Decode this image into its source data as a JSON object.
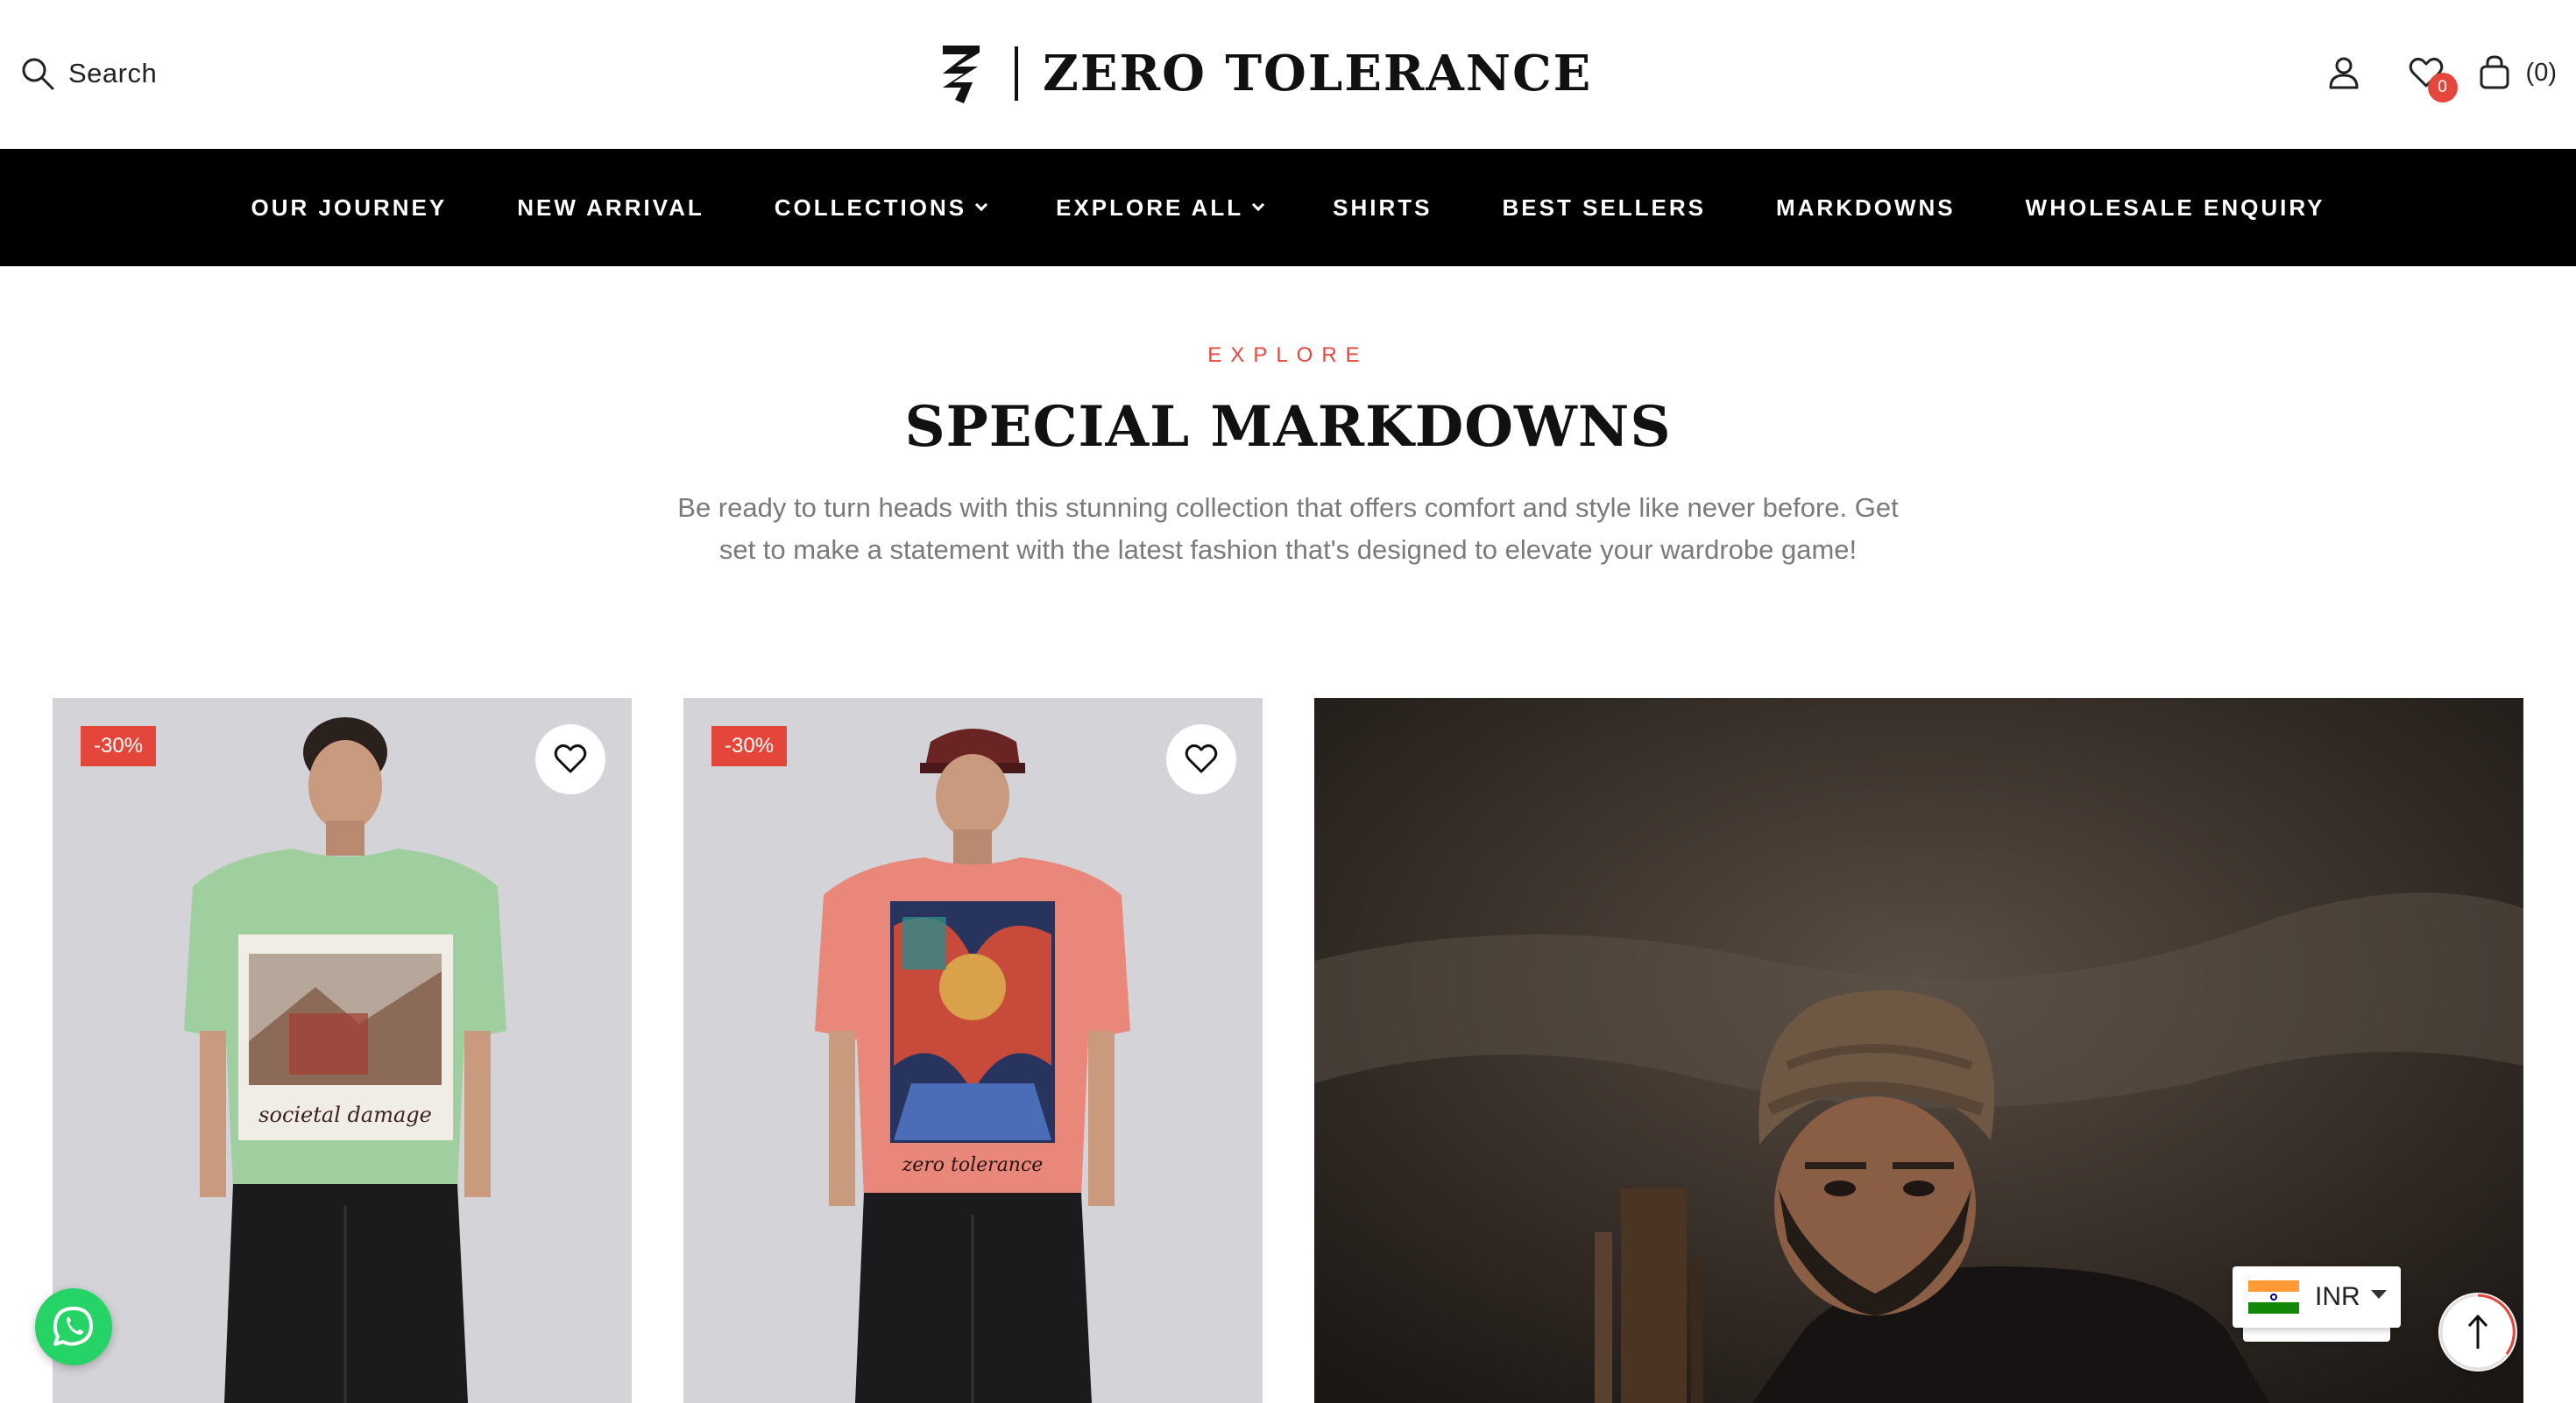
{
  "header": {
    "search_label": "Search",
    "brand": "ZERO TOLERANCE",
    "wishlist_count": "0",
    "cart_count": "(0)",
    "icons": [
      "search-icon",
      "account-icon",
      "wishlist-heart-icon",
      "bag-icon"
    ]
  },
  "nav": {
    "items": [
      {
        "label": "OUR JOURNEY",
        "dropdown": false
      },
      {
        "label": "NEW ARRIVAL",
        "dropdown": false
      },
      {
        "label": "COLLECTIONS",
        "dropdown": true
      },
      {
        "label": "EXPLORE ALL",
        "dropdown": true
      },
      {
        "label": "SHIRTS",
        "dropdown": false
      },
      {
        "label": "BEST SELLERS",
        "dropdown": false
      },
      {
        "label": "MARKDOWNS",
        "dropdown": false
      },
      {
        "label": "WHOLESALE ENQUIRY",
        "dropdown": false
      }
    ]
  },
  "section": {
    "eyebrow": "EXPLORE",
    "title": "SPECIAL MARKDOWNS",
    "description": "Be ready to turn heads with this stunning collection that offers comfort and style like never before. Get set to make a statement with the latest fashion that's designed to elevate your wardrobe game!"
  },
  "products": [
    {
      "discount": "-30%",
      "print_text": "societal damage",
      "tee_color": "#9fcf9e"
    },
    {
      "discount": "-30%",
      "print_text": "zero tolerance",
      "tee_color": "#e9877a"
    }
  ],
  "widgets": {
    "currency": "INR",
    "icons": [
      "whatsapp-icon",
      "india-flag-icon",
      "arrow-up-icon"
    ]
  },
  "colors": {
    "accent": "#e5463b",
    "nav_bg": "#000000",
    "whatsapp": "#25d366"
  }
}
